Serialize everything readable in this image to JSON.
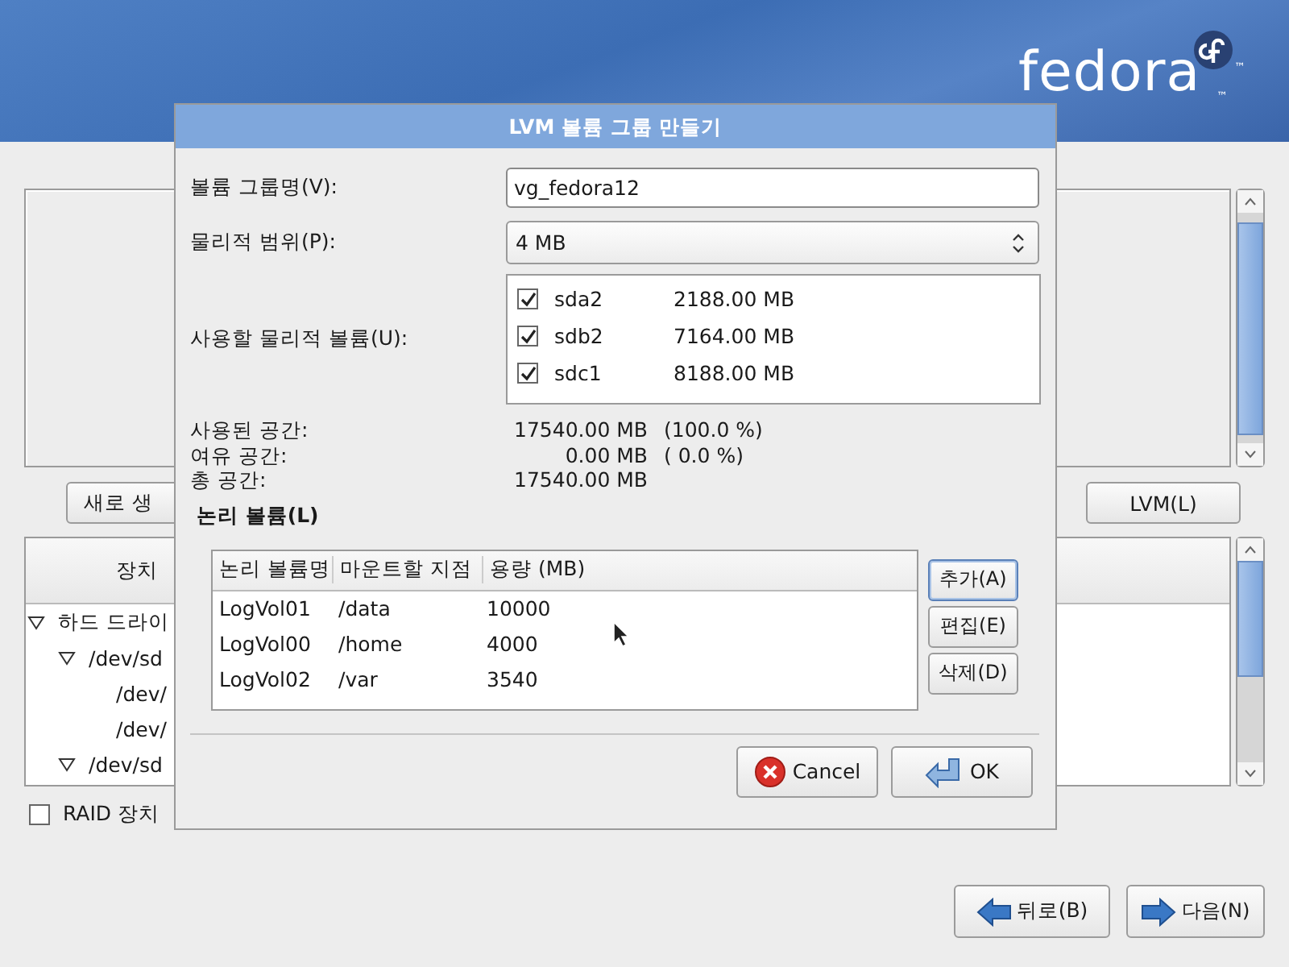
{
  "header": {
    "logo": {
      "text": "fedora",
      "marks": [
        "™",
        "™"
      ]
    }
  },
  "background": {
    "buttons": [
      {
        "label": "새로 생"
      },
      {
        "label": "LVM(L)"
      }
    ],
    "device_tree": {
      "columns": [
        "장치"
      ],
      "rows": [
        {
          "label": "하드 드라이",
          "expanded": true,
          "children": [
            {
              "label": "/dev/sd",
              "expanded": true,
              "children": [
                {
                  "label": "/dev/"
                },
                {
                  "label": "/dev/"
                }
              ]
            },
            {
              "label": "/dev/sd",
              "expanded": true
            }
          ]
        }
      ]
    },
    "raid_checkbox": {
      "label": "RAID 장치",
      "checked": false
    },
    "nav": [
      {
        "label": "뒤로(B)",
        "kind": "back"
      },
      {
        "label": "다음(N)",
        "kind": "next"
      }
    ]
  },
  "dialog": {
    "title": "LVM 볼륨 그룹 만들기",
    "name_label": "볼륨 그룹명(V):",
    "name_value": "vg_fedora12",
    "extent_label": "물리적 범위(P):",
    "extent_value": "4 MB",
    "volumes_label": "사용할 물리적 볼륨(U):",
    "volumes": [
      {
        "name": "sda2",
        "size": "2188.00 MB",
        "checked": true
      },
      {
        "name": "sdb2",
        "size": "7164.00 MB",
        "checked": true
      },
      {
        "name": "sdc1",
        "size": "8188.00 MB",
        "checked": true
      }
    ],
    "summary": [
      {
        "label": "사용된 공간:",
        "amount": "17540.00 MB",
        "percent": "(100.0 %)"
      },
      {
        "label": "여유 공간:",
        "amount": "0.00 MB",
        "percent": "( 0.0 %)"
      },
      {
        "label": "총 공간:",
        "amount": "17540.00 MB"
      }
    ],
    "lv_title": "논리 볼륨(L)",
    "lv_table": {
      "columns": [
        "논리 볼륨명",
        "마운트할 지점",
        "용량 (MB)"
      ],
      "rows": [
        [
          "LogVol01",
          "/data",
          "10000"
        ],
        [
          "LogVol00",
          "/home",
          "4000"
        ],
        [
          "LogVol02",
          "/var",
          "3540"
        ]
      ]
    },
    "lv_buttons": [
      {
        "label": "추가(A)",
        "focused": true
      },
      {
        "label": "편집(E)",
        "focused": false
      },
      {
        "label": "삭제(D)",
        "focused": false
      }
    ],
    "buttons": [
      {
        "label": "Cancel",
        "kind": "cancel"
      },
      {
        "label": "OK",
        "kind": "ok"
      }
    ]
  }
}
